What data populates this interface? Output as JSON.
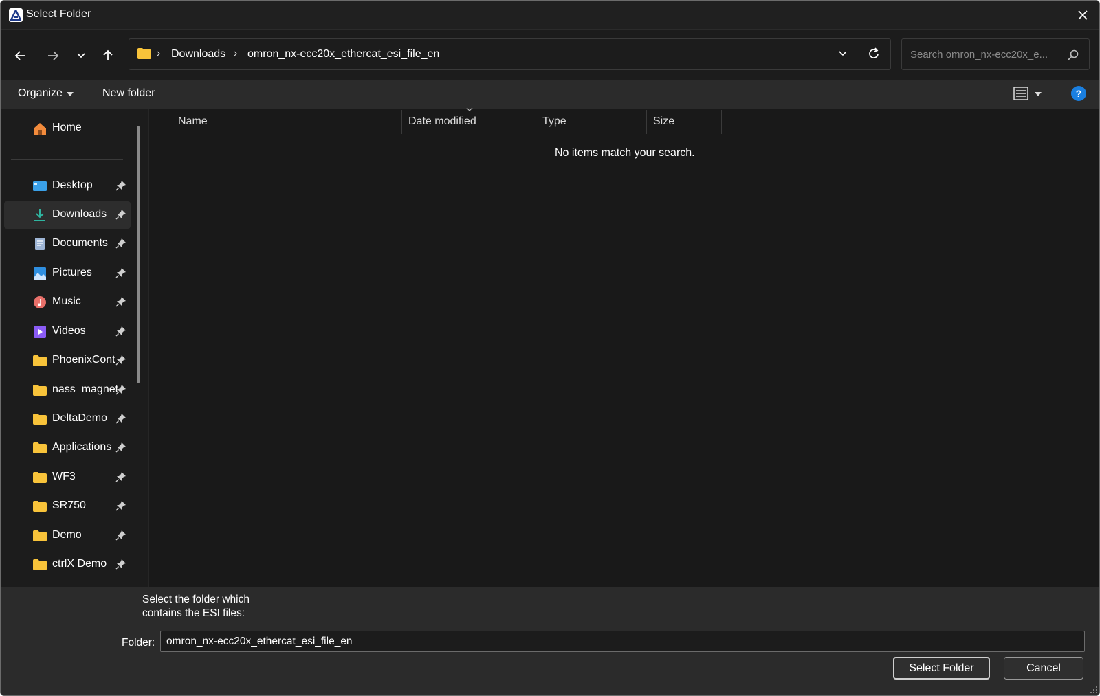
{
  "window": {
    "title": "Select Folder"
  },
  "navigation": {
    "breadcrumb": [
      "Downloads",
      "omron_nx-ecc20x_ethercat_esi_file_en"
    ],
    "search_placeholder": "Search omron_nx-ecc20x_e..."
  },
  "toolbar": {
    "organize_label": "Organize",
    "new_folder_label": "New folder"
  },
  "sidebar": {
    "home_label": "Home",
    "items": [
      {
        "label": "Desktop",
        "icon": "desktop-icon"
      },
      {
        "label": "Downloads",
        "icon": "download-icon",
        "active": true
      },
      {
        "label": "Documents",
        "icon": "documents-icon"
      },
      {
        "label": "Pictures",
        "icon": "pictures-icon"
      },
      {
        "label": "Music",
        "icon": "music-icon"
      },
      {
        "label": "Videos",
        "icon": "videos-icon"
      },
      {
        "label": "PhoenixCont",
        "icon": "folder-icon"
      },
      {
        "label": "nass_magnet",
        "icon": "folder-icon"
      },
      {
        "label": "DeltaDemo",
        "icon": "folder-icon"
      },
      {
        "label": "Applications",
        "icon": "folder-icon"
      },
      {
        "label": "WF3",
        "icon": "folder-icon"
      },
      {
        "label": "SR750",
        "icon": "folder-icon"
      },
      {
        "label": "Demo",
        "icon": "folder-icon"
      },
      {
        "label": "ctrlX Demo",
        "icon": "folder-icon"
      }
    ]
  },
  "file_list": {
    "columns": [
      "Name",
      "Date modified",
      "Type",
      "Size"
    ],
    "empty_message": "No items match your search."
  },
  "footer": {
    "hint_line1": "Select the folder which",
    "hint_line2": "contains the ESI files:",
    "folder_label": "Folder:",
    "folder_value": "omron_nx-ecc20x_ethercat_esi_file_en",
    "select_button": "Select Folder",
    "cancel_button": "Cancel"
  },
  "colors": {
    "background": "#1c1c1c",
    "panel": "#2b2b2b",
    "folder_yellow": "#f8c33a",
    "accent_blue": "#1a7fe0",
    "download_teal": "#2fb5a0"
  }
}
